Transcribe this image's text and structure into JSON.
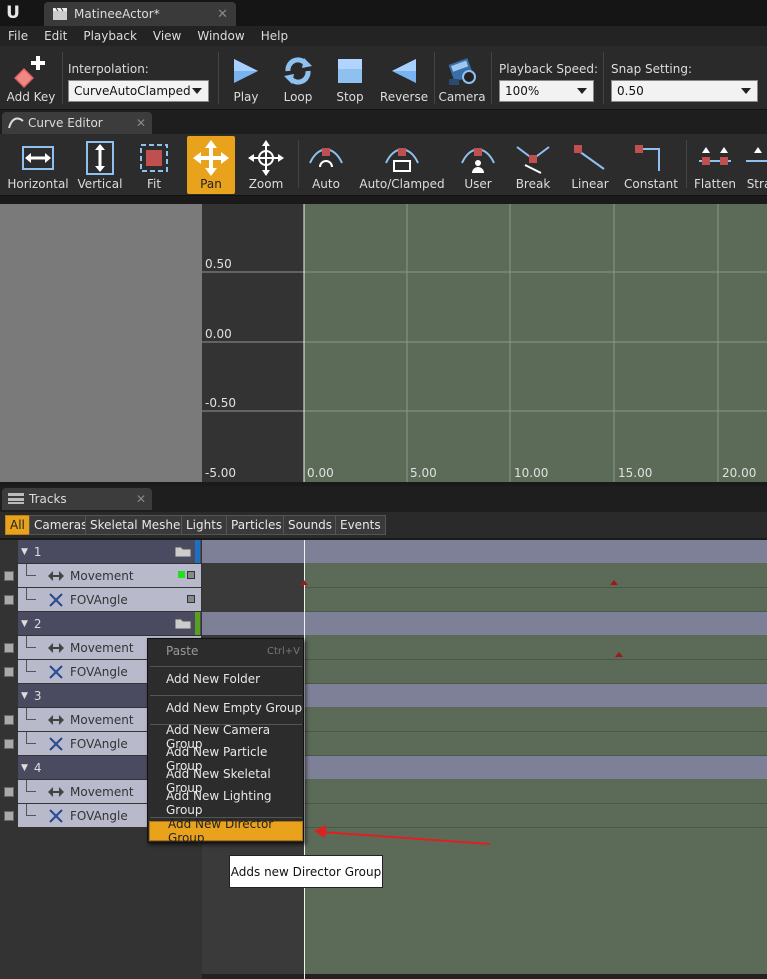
{
  "window": {
    "doc_tab": "MatineeActor*"
  },
  "menu": [
    "File",
    "Edit",
    "Playback",
    "View",
    "Window",
    "Help"
  ],
  "toolbar": {
    "add_key": "Add Key",
    "interpolation_label": "Interpolation:",
    "interpolation_value": "CurveAutoClamped",
    "play": "Play",
    "loop": "Loop",
    "stop": "Stop",
    "reverse": "Reverse",
    "camera": "Camera",
    "playback_speed_label": "Playback Speed:",
    "playback_speed_value": "100%",
    "snap_label": "Snap Setting:",
    "snap_value": "0.50"
  },
  "curve_editor": {
    "tab": "Curve Editor",
    "buttons": [
      "Horizontal",
      "Vertical",
      "Fit",
      "Pan",
      "Zoom",
      "Auto",
      "Auto/Clamped",
      "User",
      "Break",
      "Linear",
      "Constant",
      "Flatten",
      "Stra"
    ],
    "active_button": "Pan",
    "y_labels": [
      "0.50",
      "0.00",
      "-0.50",
      "-5.00"
    ],
    "x_labels": [
      "0.00",
      "5.00",
      "10.00",
      "15.00",
      "20.00"
    ]
  },
  "tracks": {
    "tab": "Tracks",
    "filters": [
      "All",
      "Cameras",
      "Skeletal Meshes",
      "Lights",
      "Particles",
      "Sounds",
      "Events"
    ],
    "active_filter": "All",
    "groups": [
      {
        "name": "1",
        "tracks": [
          "Movement",
          "FOVAngle"
        ]
      },
      {
        "name": "2",
        "tracks": [
          "Movement",
          "FOVAngle"
        ]
      },
      {
        "name": "3",
        "tracks": [
          "Movement",
          "FOVAngle"
        ]
      },
      {
        "name": "4",
        "tracks": [
          "Movement",
          "FOVAngle"
        ]
      }
    ]
  },
  "context_menu": {
    "paste": "Paste",
    "paste_shortcut": "Ctrl+V",
    "items": [
      "Add New Folder",
      "Add New Empty Group",
      "Add New Camera Group",
      "Add New Particle Group",
      "Add New Skeletal Group",
      "Add New Lighting Group",
      "Add New Director Group"
    ],
    "highlighted": "Add New Director Group"
  },
  "tooltip": "Adds new Director Group",
  "colors": {
    "accent": "#e8a21c",
    "track_green": "#5b6b58",
    "arrow": "#e02020"
  }
}
